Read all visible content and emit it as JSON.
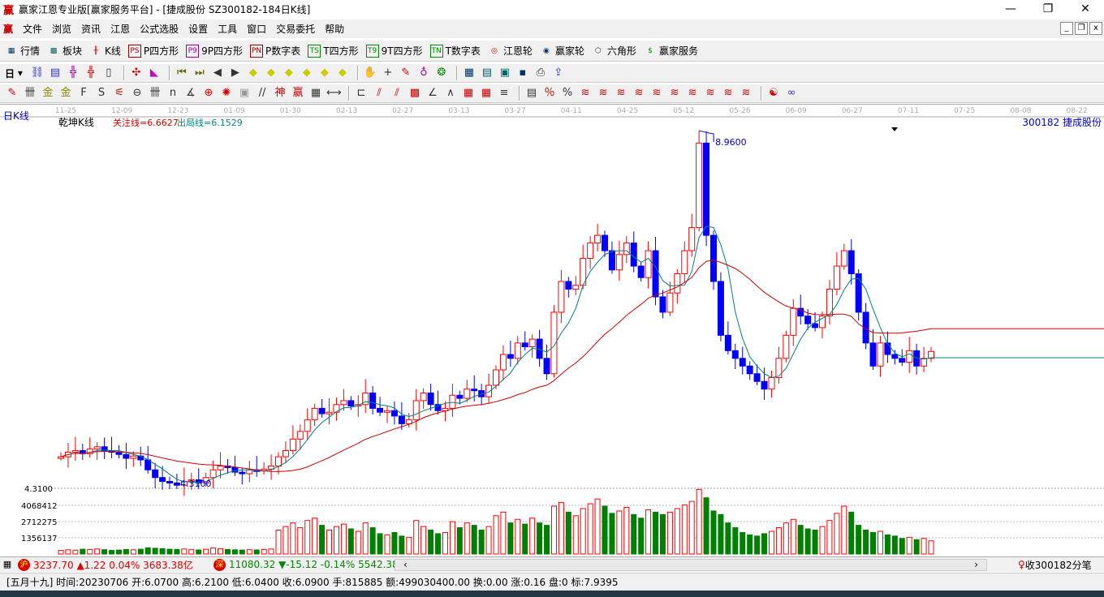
{
  "window": {
    "logo": "赢",
    "title": "赢家江恩专业版[赢家服务平台] - [捷成股份  SZ300182-184日K线]",
    "controls": [
      "minimize",
      "restore",
      "close"
    ]
  },
  "menu": {
    "logo": "赢",
    "items": [
      "文件",
      "浏览",
      "资讯",
      "江恩",
      "公式选股",
      "设置",
      "工具",
      "窗口",
      "交易委托",
      "帮助"
    ]
  },
  "toolbar1": [
    {
      "icon": "quote-table-icon",
      "label": "行情"
    },
    {
      "icon": "sector-blocks-icon",
      "label": "板块"
    },
    {
      "icon": "kline-icon",
      "label": "K线"
    },
    {
      "icon": "ps-icon",
      "glyph": "PS",
      "label": "P四方形"
    },
    {
      "icon": "p9-icon",
      "glyph": "P9",
      "label": "9P四方形"
    },
    {
      "icon": "pn-icon",
      "glyph": "PN",
      "label": "P数字表"
    },
    {
      "icon": "ts-icon",
      "glyph": "TS",
      "label": "T四方形"
    },
    {
      "icon": "t9-icon",
      "glyph": "T9",
      "label": "9T四方形"
    },
    {
      "icon": "tn-icon",
      "glyph": "TN",
      "label": "T数字表"
    },
    {
      "icon": "gann-wheel-icon",
      "label": "江恩轮"
    },
    {
      "icon": "winner-wheel-icon",
      "label": "赢家轮"
    },
    {
      "icon": "hexagon-icon",
      "label": "六角形"
    },
    {
      "icon": "dollar-icon",
      "label": "赢家服务"
    }
  ],
  "toolbar2": {
    "period": "日"
  },
  "chart": {
    "period_label": "日K线",
    "indicator_name": "乾坤K线",
    "focus_line": "关注线=6.6627",
    "exit_line": "出局线=6.1529",
    "stock": "300182  捷成股份",
    "dates": [
      "11-25",
      "12-09",
      "12-23",
      "01-09",
      "01-30",
      "02-13",
      "02-27",
      "03-13",
      "03-27",
      "04-11",
      "04-25",
      "05-12",
      "05-26",
      "06-09",
      "06-27",
      "07-11",
      "07-25",
      "08-08",
      "08-22"
    ],
    "high_label": "8.9600",
    "low_label": "4.3100",
    "low_axis": "4.3100",
    "vol_ticks": [
      "4068412",
      "2712275",
      "1356137"
    ],
    "colors": {
      "up": "#ff0000",
      "down": "#0000ff",
      "vol_up": "#ff0000",
      "vol_down": "#008000",
      "ma_fast": "#008080",
      "ma_slow": "#d00000"
    },
    "closes": [
      4.72,
      4.78,
      4.8,
      4.76,
      4.82,
      4.85,
      4.8,
      4.78,
      4.75,
      4.7,
      4.73,
      4.68,
      4.55,
      4.45,
      4.4,
      4.38,
      4.35,
      4.4,
      4.42,
      4.38,
      4.45,
      4.55,
      4.6,
      4.58,
      4.52,
      4.5,
      4.55,
      4.54,
      4.56,
      4.6,
      4.72,
      4.8,
      4.95,
      5.05,
      5.2,
      5.35,
      5.28,
      5.3,
      5.4,
      5.45,
      5.38,
      5.4,
      5.55,
      5.35,
      5.3,
      5.32,
      5.25,
      5.15,
      5.2,
      5.45,
      5.55,
      5.4,
      5.32,
      5.35,
      5.52,
      5.48,
      5.6,
      5.58,
      5.5,
      5.65,
      5.85,
      6.05,
      6.0,
      6.2,
      6.15,
      6.25,
      6.0,
      5.8,
      6.6,
      7.0,
      6.9,
      6.95,
      7.3,
      7.5,
      7.6,
      7.4,
      7.15,
      7.35,
      7.5,
      7.2,
      7.05,
      7.4,
      6.8,
      6.6,
      6.85,
      7.1,
      7.4,
      7.7,
      8.8,
      7.6,
      7.0,
      6.3,
      6.1,
      6.0,
      5.9,
      5.8,
      5.7,
      5.6,
      5.75,
      6.0,
      6.3,
      6.65,
      6.55,
      6.45,
      6.4,
      6.55,
      6.9,
      7.2,
      7.4,
      7.1,
      6.6,
      6.2,
      5.9,
      6.2,
      6.05,
      6.0,
      5.95,
      6.1,
      5.9,
      6.0,
      6.09
    ],
    "volumes": [
      300000,
      350000,
      320000,
      400000,
      380000,
      420000,
      360000,
      300000,
      330000,
      380000,
      350000,
      400000,
      520000,
      480000,
      450000,
      400000,
      380000,
      420000,
      360000,
      340000,
      400000,
      500000,
      450000,
      380000,
      350000,
      330000,
      360000,
      340000,
      380000,
      420000,
      2000000,
      2300000,
      2600000,
      2200000,
      2800000,
      3000000,
      2400000,
      2000000,
      2300000,
      2500000,
      2100000,
      1900000,
      2600000,
      2200000,
      1700000,
      1600000,
      1800000,
      1500000,
      1400000,
      2800000,
      2300000,
      2000000,
      1700000,
      1800000,
      2700000,
      2200000,
      2600000,
      2400000,
      2000000,
      2300000,
      3200000,
      3500000,
      2600000,
      2900000,
      2500000,
      3000000,
      2600000,
      2400000,
      4000000,
      4300000,
      3500000,
      3200000,
      3800000,
      4200000,
      4600000,
      4000000,
      3400000,
      3600000,
      3900000,
      3300000,
      3000000,
      3700000,
      3500000,
      3300000,
      3500000,
      3800000,
      4100000,
      4400000,
      5400000,
      4700000,
      3600000,
      3300000,
      2600000,
      2200000,
      1800000,
      1600000,
      1500000,
      1700000,
      1900000,
      2200000,
      2600000,
      2900000,
      2400000,
      2100000,
      2000000,
      2300000,
      2800000,
      3400000,
      4000000,
      3500000,
      2400000,
      2000000,
      1800000,
      1900000,
      1600000,
      1500000,
      1300000,
      1400000,
      1200000,
      1300000,
      1100000
    ]
  },
  "index_bar": {
    "sh_name": "沪",
    "sh": "3237.70 ▲1.22 0.04% 3683.38亿",
    "sz_name": "深",
    "sz": "11080.32 ▼-15.12 -0.14% 5542.38",
    "collect": "收300182分笔"
  },
  "status": "[五月十九] 时间:20230706 开:6.0700 高:6.2100 低:6.0400 收:6.0900 手:815885 额:499030400.00 换:0.00 涨:0.16 盘:0 标:7.9395"
}
